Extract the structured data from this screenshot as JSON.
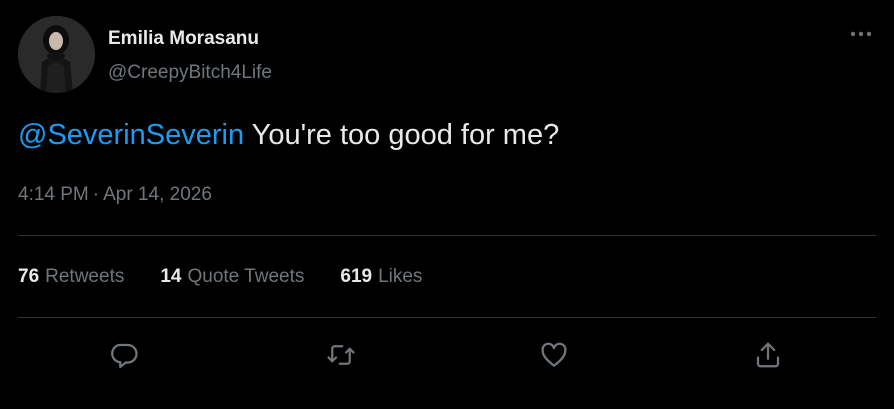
{
  "author": {
    "display_name": "Emilia Morasanu",
    "handle": "@CreepyBitch4Life",
    "avatar_icon": "avatar-photo"
  },
  "tweet": {
    "mention": "@SeverinSeverin",
    "text": " You're too good for me?",
    "time": "4:14 PM",
    "separator": "·",
    "date": "Apr 14, 2026"
  },
  "stats": [
    {
      "count": "76",
      "label": "Retweets"
    },
    {
      "count": "14",
      "label": "Quote Tweets"
    },
    {
      "count": "619",
      "label": "Likes"
    }
  ],
  "actions": {
    "reply_icon": "reply-icon",
    "retweet_icon": "retweet-icon",
    "like_icon": "heart-icon",
    "share_icon": "share-icon",
    "more_icon": "more-icon"
  },
  "colors": {
    "background": "#000000",
    "text_primary": "#e7e9ea",
    "text_secondary": "#71767b",
    "accent": "#1d9bf0",
    "divider": "#2f3336"
  }
}
